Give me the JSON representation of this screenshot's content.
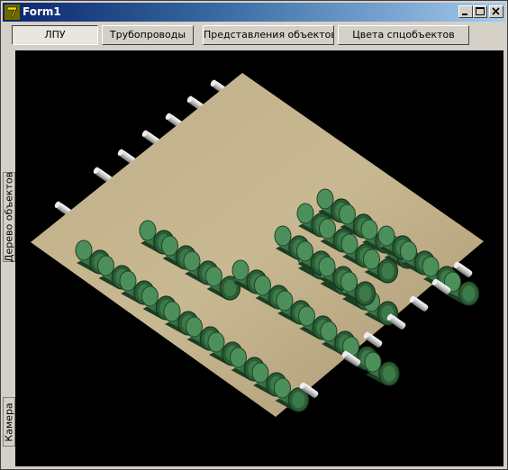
{
  "window": {
    "title": "Form1",
    "icon": "delphi-app-icon",
    "controls": [
      "minimize-icon",
      "maximize-icon",
      "close-icon"
    ]
  },
  "toolbar": {
    "buttons": [
      {
        "label": "ЛПУ",
        "pressed": true
      },
      {
        "label": "Трубопроводы",
        "pressed": false
      },
      {
        "label": "Представления объектов",
        "pressed": false
      },
      {
        "label": "Цвета спцобъектов",
        "pressed": false
      }
    ]
  },
  "side_tabs": [
    {
      "label": "Дерево объектов"
    },
    {
      "label": "Камера"
    }
  ],
  "scene": {
    "background": "#000000",
    "plate_color": "#b5a37f",
    "unit_color": "#2f6b3c",
    "pipe_color": "#d8d8d8"
  }
}
